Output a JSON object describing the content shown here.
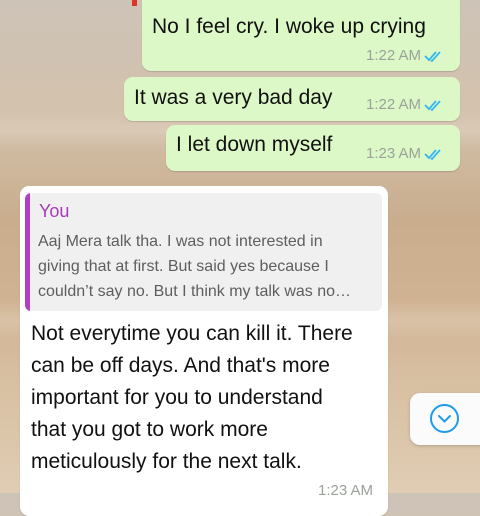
{
  "messages_out": [
    {
      "text": "No I feel cry. I woke up crying",
      "time": "1:22 AM",
      "status": "read"
    },
    {
      "text": "It was a very bad day",
      "time": "1:22 AM",
      "status": "read"
    },
    {
      "text": "I let down myself",
      "time": "1:23 AM",
      "status": "read"
    }
  ],
  "message_in": {
    "quote": {
      "author": "You",
      "lines": [
        "Aaj Mera talk tha. I was not interested in",
        "giving that at first. But said yes because I",
        "couldn’t say no. But I think my talk was no…"
      ]
    },
    "lines": [
      "Not everytime you can kill it. There",
      "can be off days. And that's more",
      "important for you to understand",
      "that you got to work more",
      "meticulously for the next talk."
    ],
    "time": "1:23 AM"
  },
  "icons": {
    "read_ticks": "double-check-icon",
    "scroll_down": "chevron-down-circle-icon"
  },
  "colors": {
    "outgoing_bubble": "#dcf8c6",
    "incoming_bubble": "#ffffff",
    "read_tick": "#34b7f1",
    "quote_accent": "#b23ec3",
    "scroll_accent": "#1e9bea"
  }
}
